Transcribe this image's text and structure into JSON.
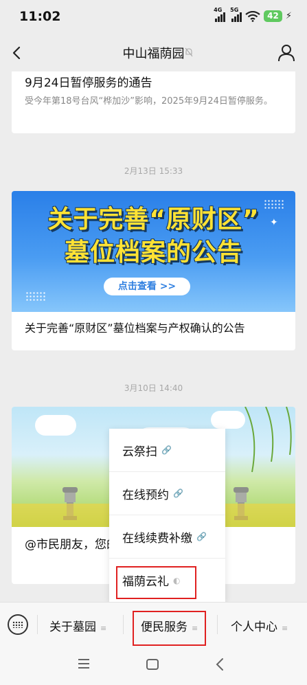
{
  "status_bar": {
    "time": "11:02",
    "network_1": "4G",
    "network_2": "5G",
    "battery": "42"
  },
  "header": {
    "title": "中山福荫园"
  },
  "messages": [
    {
      "title": "9月24日暂停服务的通告",
      "desc": "受今年第18号台风“桦加沙”影响，2025年9月24日暂停服务。"
    },
    {
      "timestamp": "2月13日 15:33",
      "banner_line1": "关于完善“原财区”",
      "banner_line2": "墓位档案的公告",
      "banner_button": "点击查看 >>",
      "title": "关于完善“原财区”墓位档案与产权确认的公告"
    },
    {
      "timestamp": "3月10日 14:40",
      "title": "@市民朋友，您的便民服务信息待查收"
    }
  ],
  "popup_menu": {
    "items": [
      "云祭扫",
      "在线预约",
      "在线续费补缴",
      "福荫云礼"
    ]
  },
  "bottom_menu": {
    "items": [
      "关于墓园",
      "便民服务",
      "个人中心"
    ]
  },
  "colors": {
    "background": "#ededed",
    "highlight": "#e02020",
    "banner_blue": "#2a7fe8",
    "banner_text": "#ffe234",
    "battery": "#5fc95f"
  }
}
